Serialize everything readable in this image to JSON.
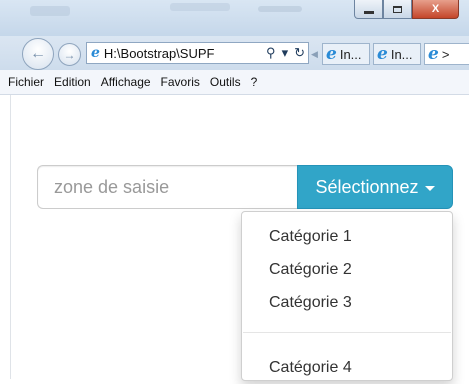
{
  "window": {
    "minimize_label": "",
    "maximize_label": "",
    "close_label": "X"
  },
  "nav": {
    "address": "H:\\Bootstrap\\SUPF",
    "search_glyph": "⚲",
    "dropdown_glyph": "▾",
    "refresh_glyph": "↻",
    "tabs": [
      {
        "label": "In..."
      },
      {
        "label": "In..."
      },
      {
        "label": ">"
      }
    ]
  },
  "menubar": {
    "items": [
      "Fichier",
      "Edition",
      "Affichage",
      "Favoris",
      "Outils",
      "?"
    ]
  },
  "form": {
    "input_placeholder": "zone de saisie",
    "select_label": "Sélectionnez"
  },
  "dropdown": {
    "items": [
      "Catégorie 1",
      "Catégorie 2",
      "Catégorie 3",
      "Catégorie 4"
    ]
  },
  "colors": {
    "button_bg": "#31a5c8",
    "ie_blue": "#2a8bd6"
  }
}
